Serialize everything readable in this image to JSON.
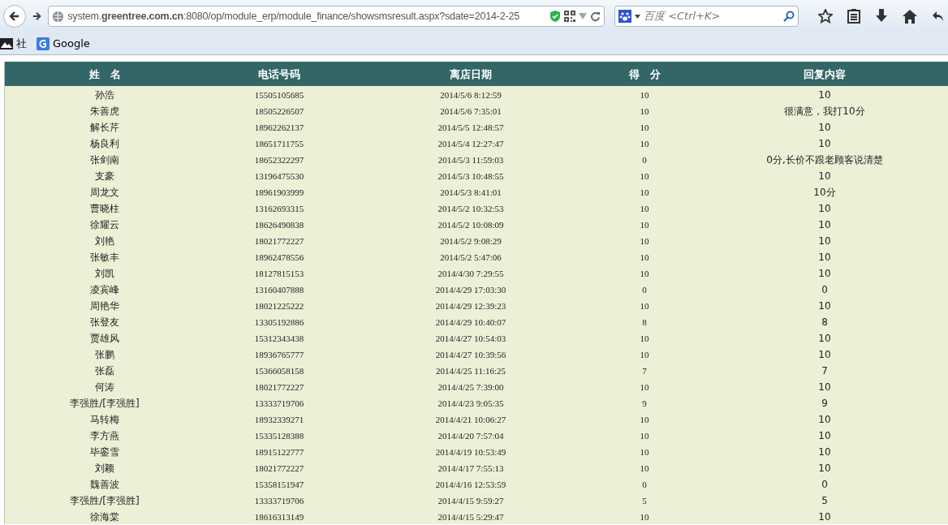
{
  "browser": {
    "url": "system.**greentree.com.cn**:8080/op/module_erp/module_finance/showsmsresult.aspx?sdate=2014-2-25",
    "search": {
      "placeholder": "百度 <Ctrl+K>"
    }
  },
  "bookmarks": [
    {
      "label": "社"
    },
    {
      "label": "Google"
    }
  ],
  "table": {
    "columns": [
      "姓　名",
      "电话号码",
      "离店日期",
      "得　分",
      "回复内容"
    ],
    "rows": [
      [
        "孙浩",
        "15505105685",
        "2014/5/6 8:12:59",
        "10",
        "10"
      ],
      [
        "朱善虎",
        "18505226507",
        "2014/5/6 7:35:01",
        "10",
        "很满意，我打10分"
      ],
      [
        "解长芹",
        "18962262137",
        "2014/5/5 12:48:57",
        "10",
        "10"
      ],
      [
        "杨良利",
        "18651711755",
        "2014/5/4 12:27:47",
        "10",
        "10"
      ],
      [
        "张剑南",
        "18652322297",
        "2014/5/3 11:59:03",
        "0",
        "0分,长价不跟老顾客说清楚"
      ],
      [
        "支豪",
        "13196475530",
        "2014/5/3 10:48:55",
        "10",
        "10"
      ],
      [
        "周龙文",
        "18961903999",
        "2014/5/3 8:41:01",
        "10",
        "10分"
      ],
      [
        "曹晓柱",
        "13162693315",
        "2014/5/2 10:32:53",
        "10",
        "10"
      ],
      [
        "徐耀云",
        "18626490838",
        "2014/5/2 10:08:09",
        "10",
        "10"
      ],
      [
        "刘艳",
        "18021772227",
        "2014/5/2 9:08:29",
        "10",
        "10"
      ],
      [
        "张敏丰",
        "18962478556",
        "2014/5/2 5:47:06",
        "10",
        "10"
      ],
      [
        "刘凯",
        "18127815153",
        "2014/4/30 7:29:55",
        "10",
        "10"
      ],
      [
        "凌宾峰",
        "13160407888",
        "2014/4/29 17:03:30",
        "0",
        "0"
      ],
      [
        "周艳华",
        "18021225222",
        "2014/4/29 12:39:23",
        "10",
        "10"
      ],
      [
        "张登友",
        "13305192886",
        "2014/4/29 10:40:07",
        "8",
        "8"
      ],
      [
        "贾雄风",
        "15312343438",
        "2014/4/27 10:54:03",
        "10",
        "10"
      ],
      [
        "张鹏",
        "18936765777",
        "2014/4/27 10:39:56",
        "10",
        "10"
      ],
      [
        "张磊",
        "15366058158",
        "2014/4/25 11:16:25",
        "7",
        "7"
      ],
      [
        "何涛",
        "18021772227",
        "2014/4/25 7:39:00",
        "10",
        "10"
      ],
      [
        "李强胜/[李强胜]",
        "13333719706",
        "2014/4/23 9:05:35",
        "9",
        "9"
      ],
      [
        "马转梅",
        "18932339271",
        "2014/4/21 10:06:27",
        "10",
        "10"
      ],
      [
        "李方燕",
        "15335128388",
        "2014/4/20 7:57:04",
        "10",
        "10"
      ],
      [
        "毕銮雪",
        "18915122777",
        "2014/4/19 10:53:49",
        "10",
        "10"
      ],
      [
        "刘颖",
        "18021772227",
        "2014/4/17 7:55:13",
        "10",
        "10"
      ],
      [
        "魏善波",
        "15358151947",
        "2014/4/16 12:53:59",
        "0",
        "0"
      ],
      [
        "李强胜/[李强胜]",
        "13333719706",
        "2014/4/15 9:59:27",
        "5",
        "5"
      ],
      [
        "徐海棠",
        "18616313149",
        "2014/4/15 5:29:47",
        "10",
        "10"
      ]
    ]
  }
}
